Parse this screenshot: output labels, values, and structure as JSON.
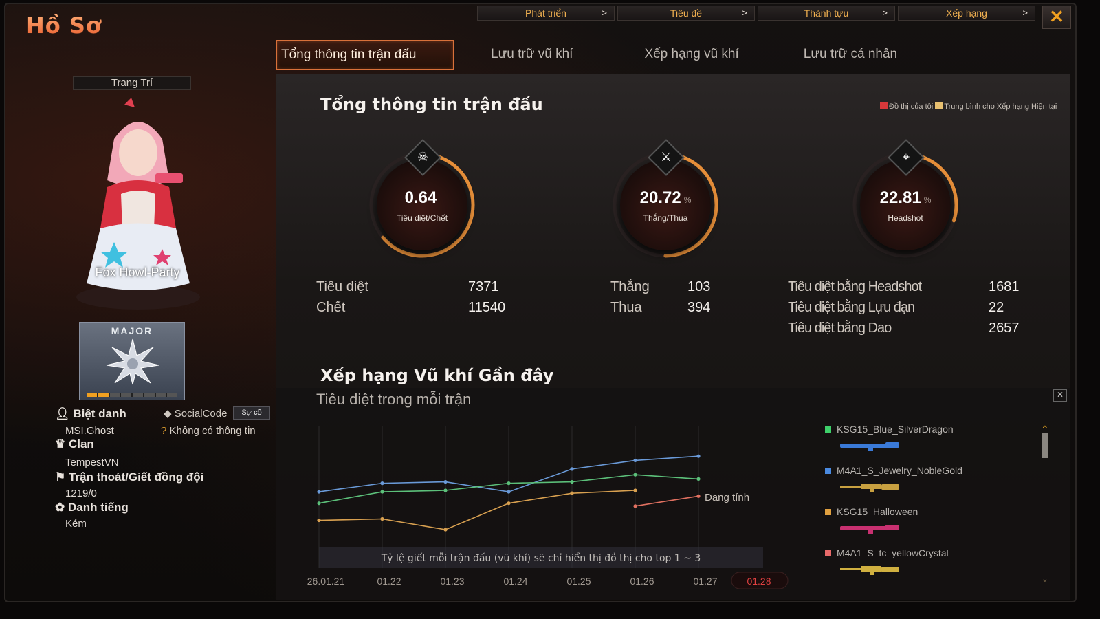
{
  "window": {
    "title": "Hồ Sơ",
    "close_label": "✕"
  },
  "top_nav": [
    {
      "label": "Phát triển",
      "chevron": ">"
    },
    {
      "label": "Tiêu đề",
      "chevron": ">"
    },
    {
      "label": "Thành tựu",
      "chevron": ">"
    },
    {
      "label": "Xếp hạng",
      "chevron": ">"
    }
  ],
  "tabs": [
    {
      "label": "Tổng thông tin trận đấu",
      "active": true
    },
    {
      "label": "Lưu trữ vũ khí",
      "active": false
    },
    {
      "label": "Xếp hạng vũ khí",
      "active": false
    },
    {
      "label": "Lưu trữ cá nhân",
      "active": false
    }
  ],
  "profile": {
    "decoration_label": "Trang Trí",
    "character_name": "Fox Howl-Party",
    "rank": {
      "name": "MAJOR",
      "progress_segments_filled": 2,
      "progress_segments_total": 8
    },
    "nickname_label": "Biệt danh",
    "nickname": "MSI.Ghost",
    "social_code_label": "SocialCode",
    "social_button": "Sự cố",
    "social_info": "Không có thông tin",
    "clan_label": "Clan",
    "clan": "TempestVN",
    "escape_label": "Trận thoát/Giết đồng đội",
    "escape_value": "1219/0",
    "reputation_label": "Danh tiếng",
    "reputation": "Kém"
  },
  "summary": {
    "title": "Tổng thông tin trận đấu",
    "legend": [
      {
        "label": "Đồ thị của tôi",
        "color": "#d8383a"
      },
      {
        "label": "Trung bình cho Xếp hạng Hiện tại",
        "color": "#e8c070"
      }
    ],
    "gauges": [
      {
        "value": "0.64",
        "unit": "",
        "label": "Tiêu diệt/Chết",
        "icon": "skull-icon",
        "glyph": "☠",
        "fill": 0.64
      },
      {
        "value": "20.72",
        "unit": "%",
        "label": "Thắng/Thua",
        "icon": "crossed-swords-icon",
        "glyph": "⚔",
        "fill": 0.5
      },
      {
        "value": "22.81",
        "unit": "%",
        "label": "Headshot",
        "icon": "crosshair-icon",
        "glyph": "⌖",
        "fill": 0.3
      }
    ],
    "kill_death": [
      {
        "label": "Tiêu diệt",
        "value": "7371"
      },
      {
        "label": "Chết",
        "value": "11540"
      }
    ],
    "win_loss": [
      {
        "label": "Thắng",
        "value": "103"
      },
      {
        "label": "Thua",
        "value": "394"
      }
    ],
    "special_kills": [
      {
        "label": "Tiêu diệt bằng Headshot",
        "value": "1681"
      },
      {
        "label": "Tiêu diệt bằng Lựu đạn",
        "value": "22"
      },
      {
        "label": "Tiêu diệt bằng Dao",
        "value": "2657"
      }
    ]
  },
  "weapon_ranking": {
    "title": "Xếp hạng Vũ khí Gần đây",
    "subtitle": "Tiêu diệt trong mỗi trận",
    "close_label": "✕",
    "pending_label": "Đang tính",
    "note": "Tỷ lệ giết mỗi trận đấu (vũ khí) sẽ chỉ hiển thị đồ thị cho top 1 ~ 3",
    "weapons": [
      {
        "name": "KSG15_Blue_SilverDragon",
        "color": "#3ed06a",
        "gun_color": "#3a7ad8"
      },
      {
        "name": "M4A1_S_Jewelry_NobleGold",
        "color": "#4a8ae0",
        "gun_color": "#c8a040"
      },
      {
        "name": "KSG15_Halloween",
        "color": "#e0a040",
        "gun_color": "#c83070"
      },
      {
        "name": "M4A1_S_tc_yellowCrystal",
        "color": "#e86a6a",
        "gun_color": "#d0b040"
      }
    ]
  },
  "chart_data": {
    "type": "line",
    "title": "Tiêu diệt trong mỗi trận",
    "x": [
      "26.01.21",
      "01.22",
      "01.23",
      "01.24",
      "01.25",
      "01.26",
      "01.27",
      "01.28"
    ],
    "highlight_x": "01.28",
    "series": [
      {
        "color": "#6a9ad8",
        "values": [
          0.78,
          0.9,
          0.92,
          0.78,
          1.1,
          1.22,
          1.28,
          null
        ]
      },
      {
        "color": "#5cc07a",
        "values": [
          0.62,
          0.78,
          0.8,
          0.9,
          0.92,
          1.02,
          0.96,
          null
        ]
      },
      {
        "color": "#d8a050",
        "values": [
          0.38,
          0.4,
          0.25,
          0.62,
          0.76,
          0.8,
          null,
          null
        ]
      },
      {
        "color": "#e07060",
        "values": [
          null,
          null,
          null,
          null,
          null,
          0.58,
          0.72,
          null
        ]
      }
    ],
    "ylim": [
      0,
      1.6
    ],
    "grid": true
  }
}
